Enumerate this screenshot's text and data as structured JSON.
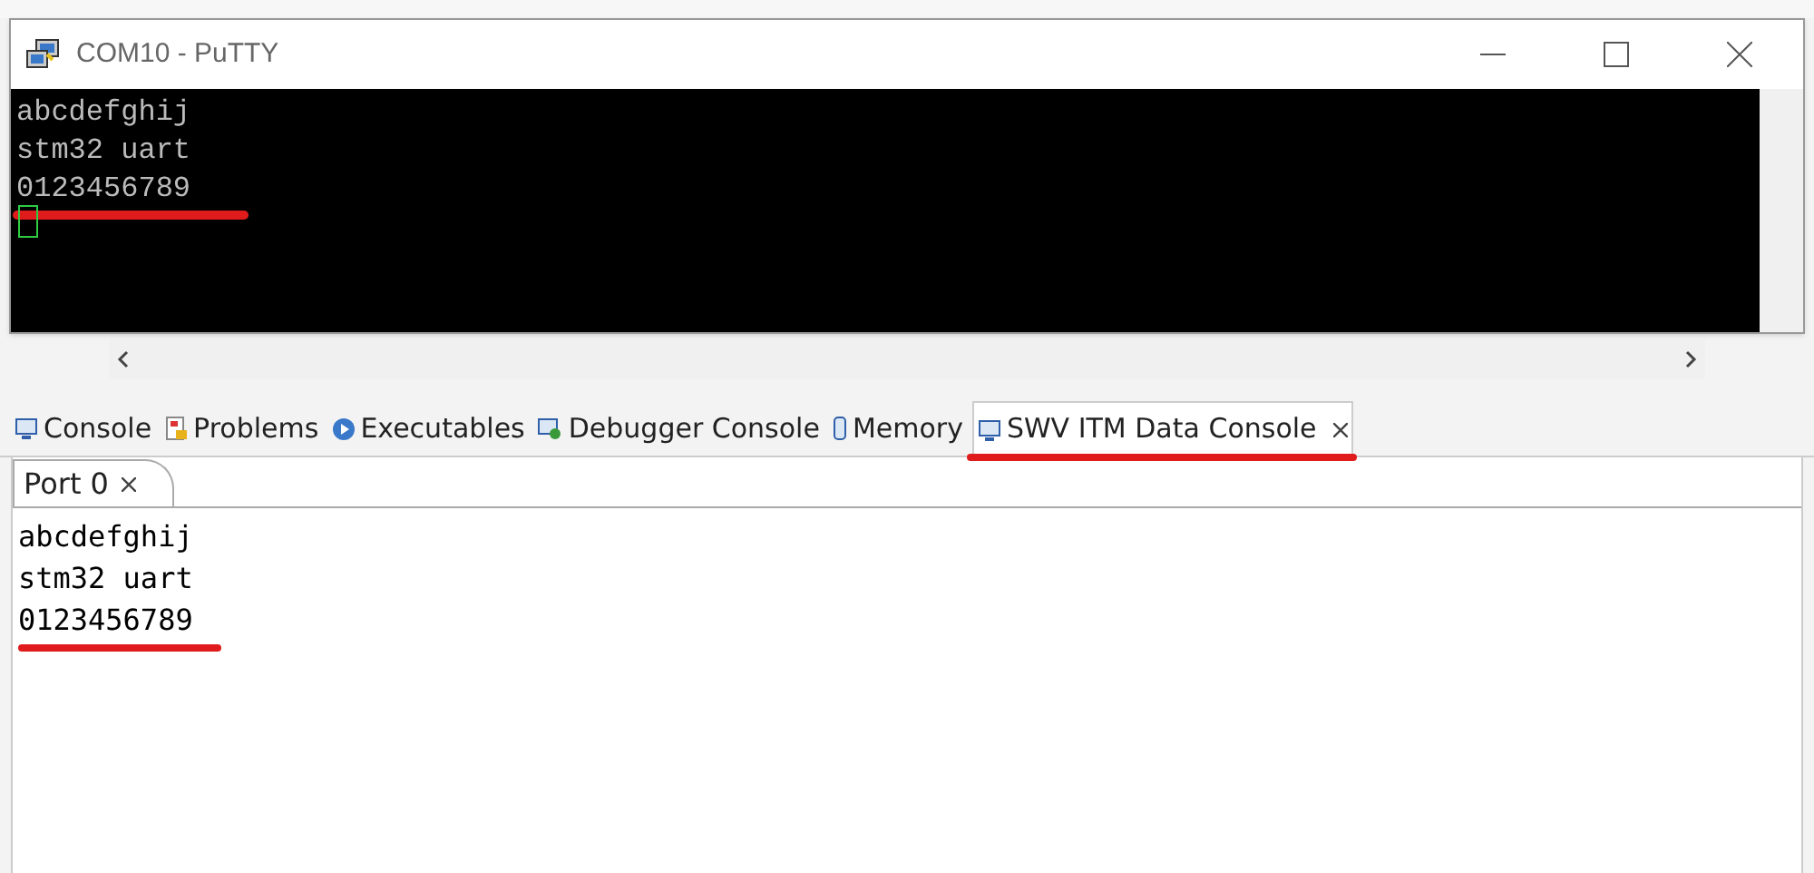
{
  "terminal_window": {
    "title": "COM10 - PuTTY",
    "lines": [
      "abcdefghij",
      "stm32 uart",
      "0123456789"
    ]
  },
  "tabs": [
    {
      "label": "Console",
      "kind": "console",
      "selected": false,
      "closable": false
    },
    {
      "label": "Problems",
      "kind": "problems",
      "selected": false,
      "closable": false
    },
    {
      "label": "Executables",
      "kind": "executables",
      "selected": false,
      "closable": false
    },
    {
      "label": "Debugger Console",
      "kind": "debugger",
      "selected": false,
      "closable": false
    },
    {
      "label": "Memory",
      "kind": "memory",
      "selected": false,
      "closable": false
    },
    {
      "label": "SWV ITM Data Console",
      "kind": "console",
      "selected": true,
      "closable": true
    }
  ],
  "port_tab": {
    "label": "Port 0",
    "selected": true
  },
  "console_lines": [
    "abcdefghij",
    "stm32 uart",
    "0123456789"
  ]
}
